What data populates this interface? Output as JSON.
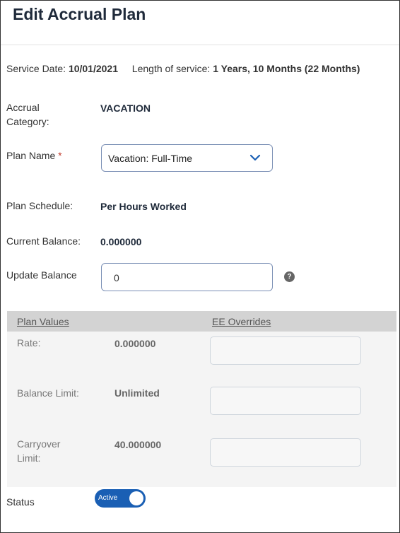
{
  "header": {
    "title": "Edit Accrual Plan"
  },
  "service": {
    "date_label": "Service Date:",
    "date_value": "10/01/2021",
    "length_label": "Length of service:",
    "length_value": "1 Years, 10 Months (22 Months)"
  },
  "accrual_category": {
    "label_line1": "Accrual",
    "label_line2": "Category:",
    "value": "VACATION"
  },
  "plan_name": {
    "label": "Plan Name",
    "required_mark": "*",
    "selected": "Vacation: Full-Time",
    "icon": "chevron-down-icon"
  },
  "plan_schedule": {
    "label": "Plan Schedule:",
    "value": "Per Hours Worked"
  },
  "current_balance": {
    "label": "Current Balance:",
    "value": "0.000000"
  },
  "update_balance": {
    "label": "Update Balance",
    "value": "0",
    "help_icon": "?"
  },
  "plan_table": {
    "col_plan_values": "Plan Values",
    "col_ee_overrides": "EE Overrides",
    "rows": [
      {
        "label_line1": "Rate:",
        "label_line2": "",
        "value": "0.000000",
        "override": ""
      },
      {
        "label_line1": "Balance Limit:",
        "label_line2": "",
        "value": "Unlimited",
        "override": ""
      },
      {
        "label_line1": "Carryover",
        "label_line2": "Limit:",
        "value": "40.000000",
        "override": ""
      }
    ]
  },
  "status": {
    "label": "Status",
    "toggle_text": "Active",
    "on": true
  },
  "colors": {
    "accent": "#1a5fb4",
    "title": "#1f2a3a",
    "panel_bg": "#f4f4f4",
    "panel_header": "#d3d3d3"
  }
}
